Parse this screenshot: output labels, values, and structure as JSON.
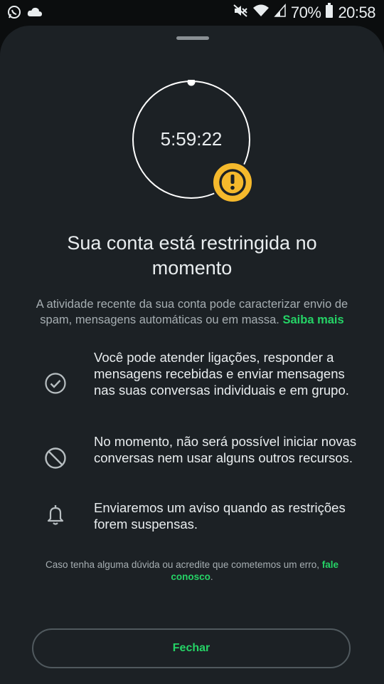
{
  "status_bar": {
    "battery": "70%",
    "time": "20:58",
    "icons": [
      "whatsapp-icon",
      "cloud-icon",
      "mute-icon",
      "wifi-icon",
      "signal-icon",
      "battery-icon"
    ]
  },
  "timer": {
    "value": "5:59:22"
  },
  "title": "Sua conta está restringida no momento",
  "description": {
    "text": "A atividade recente da sua conta pode caracterizar envio de spam, mensagens automáticas ou em massa.",
    "link": "Saiba mais"
  },
  "items": [
    {
      "icon": "check-circle-icon",
      "text": "Você pode atender ligações, responder a mensagens recebidas e enviar mensagens nas suas conversas individuais e em grupo."
    },
    {
      "icon": "block-icon",
      "text": "No momento, não será possível iniciar novas conversas nem usar alguns outros recursos."
    },
    {
      "icon": "bell-icon",
      "text": "Enviaremos um aviso quando as restrições forem suspensas."
    }
  ],
  "footer": {
    "text": "Caso tenha alguma dúvida ou acredite que cometemos um erro,",
    "link": "fale conosco",
    "suffix": "."
  },
  "close_button": "Fechar",
  "colors": {
    "accent": "#25d366",
    "warning": "#f5b92c",
    "sheet": "#1c2125"
  }
}
